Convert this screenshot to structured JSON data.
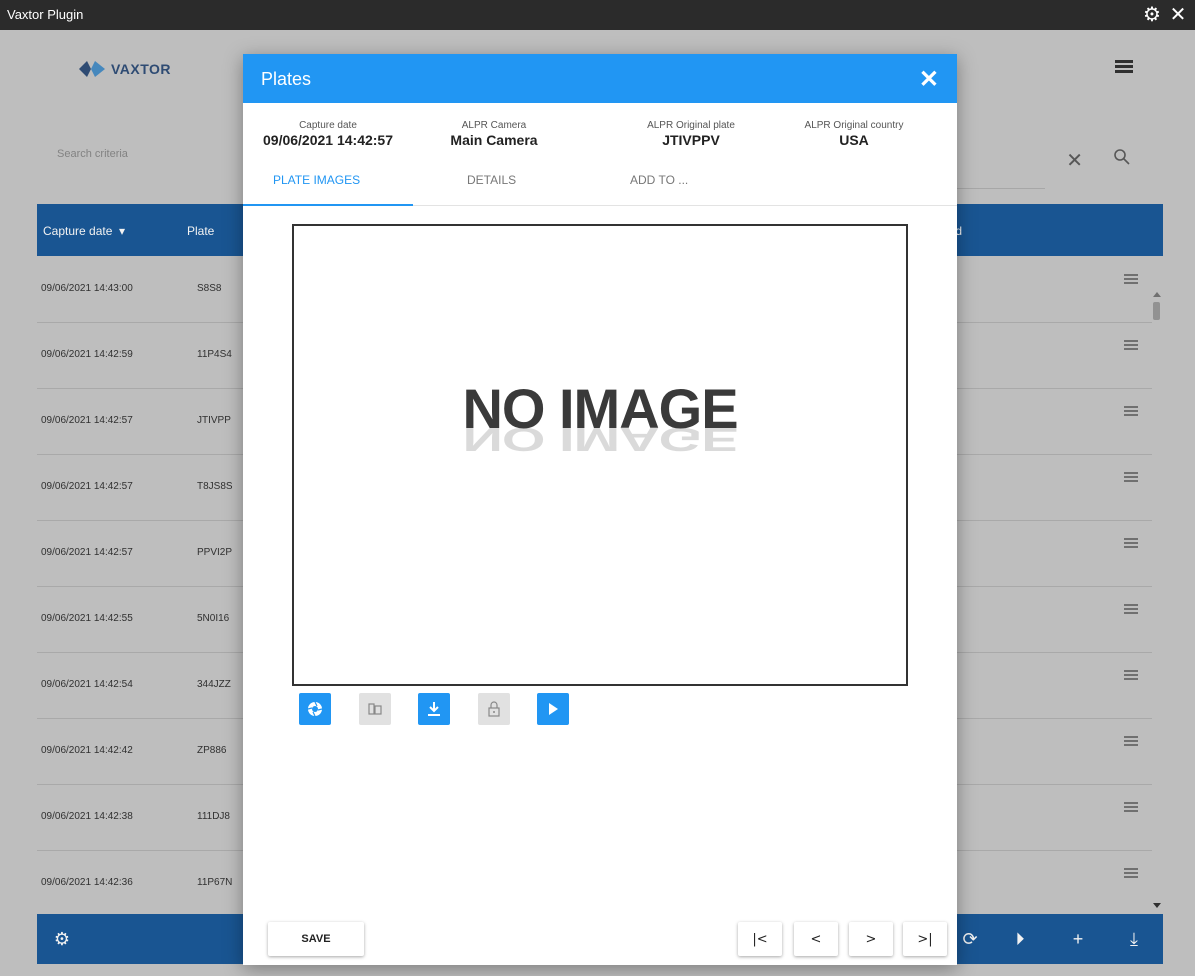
{
  "window": {
    "title": "Vaxtor Plugin",
    "settings_glyph": "⚙",
    "close_glyph": "✕"
  },
  "app": {
    "logo_text": "VAXTOR",
    "search": {
      "placeholder": "Search criteria",
      "clear_glyph": "✕"
    },
    "table": {
      "columns": [
        "Capture date",
        "Plate",
        "eed"
      ],
      "rows": [
        {
          "date": "09/06/2021 14:43:00",
          "plate": "S8S8"
        },
        {
          "date": "09/06/2021 14:42:59",
          "plate": "11P4S4"
        },
        {
          "date": "09/06/2021 14:42:57",
          "plate": "JTIVPP"
        },
        {
          "date": "09/06/2021 14:42:57",
          "plate": "T8JS8S"
        },
        {
          "date": "09/06/2021 14:42:57",
          "plate": "PPVI2P"
        },
        {
          "date": "09/06/2021 14:42:55",
          "plate": "5N0I16"
        },
        {
          "date": "09/06/2021 14:42:54",
          "plate": "344JZZ"
        },
        {
          "date": "09/06/2021 14:42:42",
          "plate": "ZP886"
        },
        {
          "date": "09/06/2021 14:42:38",
          "plate": "111DJ8"
        },
        {
          "date": "09/06/2021 14:42:36",
          "plate": "11P67N"
        }
      ]
    },
    "footer_icons": [
      "gear-icon",
      "refresh-icon",
      "play-icon",
      "add-icon",
      "download-icon"
    ],
    "footer_glyphs": {
      "gear": "⚙",
      "refresh": "⟳",
      "play": "⏵",
      "add": "+",
      "download": "⤓"
    }
  },
  "dialog": {
    "title": "Plates",
    "close_glyph": "✕",
    "info": [
      {
        "label": "Capture date",
        "value": "09/06/2021 14:42:57"
      },
      {
        "label": "ALPR Camera",
        "value": "Main Camera"
      },
      {
        "label": "ALPR Original plate",
        "value": "JTIVPPV"
      },
      {
        "label": "ALPR Original country",
        "value": "USA"
      }
    ],
    "tabs": [
      {
        "label": "PLATE IMAGES",
        "active": true
      },
      {
        "label": "DETAILS",
        "active": false
      },
      {
        "label": "ADD TO ...",
        "active": false
      }
    ],
    "image_placeholder": "NO IMAGE",
    "toolbar": [
      "camera-icon",
      "compare-icon",
      "download-icon",
      "lock-icon",
      "play-icon"
    ],
    "save_label": "SAVE",
    "nav": {
      "first": "|<",
      "prev": "<",
      "next": ">",
      "last": ">|"
    }
  },
  "colors": {
    "primary": "#2196f3",
    "table_header": "#1b5a9a",
    "titlebar": "#2b2b2b",
    "background": "#c9c9c9"
  }
}
